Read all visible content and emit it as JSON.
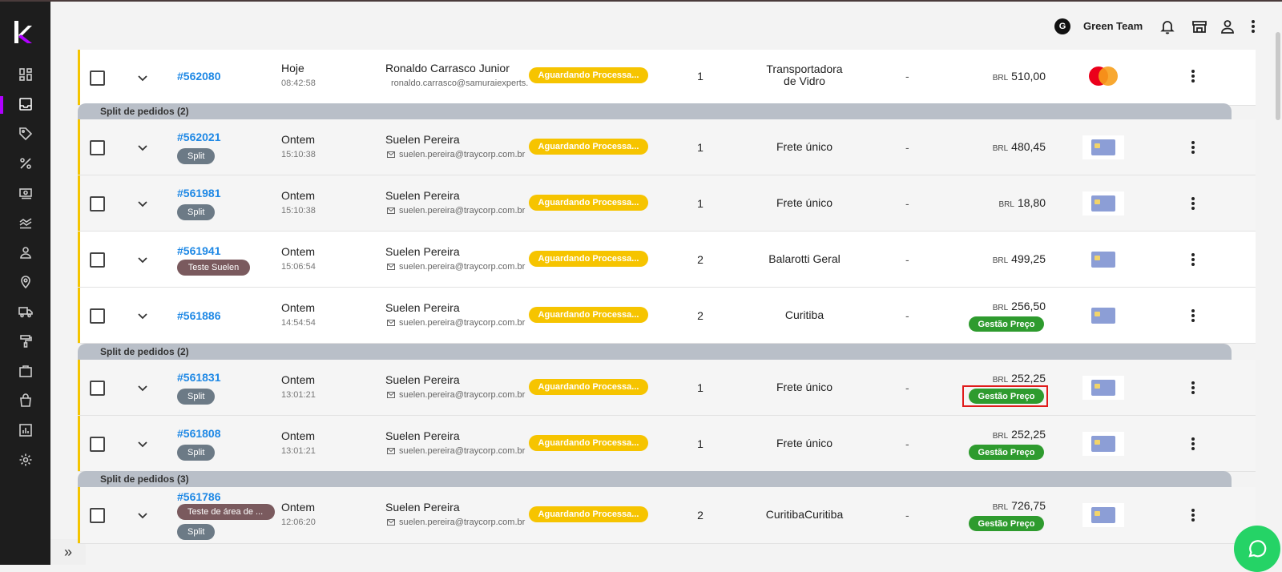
{
  "header": {
    "team_initial": "G",
    "team_name": "Green Team"
  },
  "sidebar": {
    "items": [
      {
        "icon": "dashboard-icon"
      },
      {
        "icon": "inbox-icon",
        "active": true
      },
      {
        "icon": "tag-icon"
      },
      {
        "icon": "percent-icon"
      },
      {
        "icon": "money-icon"
      },
      {
        "icon": "chart-lines-icon"
      },
      {
        "icon": "user-icon"
      },
      {
        "icon": "location-pin-icon"
      },
      {
        "icon": "truck-icon"
      },
      {
        "icon": "paint-roller-icon"
      },
      {
        "icon": "briefcase-icon"
      },
      {
        "icon": "shopping-bag-icon"
      },
      {
        "icon": "report-icon"
      },
      {
        "icon": "settings-icon"
      }
    ],
    "collapse_label": "»"
  },
  "groups": [
    {
      "label": "Split de pedidos (2)"
    },
    {
      "label": "Split de pedidos (2)"
    },
    {
      "label": "Split de pedidos (3)"
    }
  ],
  "orders": [
    {
      "id": "#562080",
      "tags": [],
      "date": "Hoje",
      "time": "08:42:58",
      "customer": "Ronaldo Carrasco Junior",
      "email": "ronaldo.carrasco@samuraiexperts.com",
      "status": "Aguardando Processa...",
      "qty": "1",
      "shipping_line1": "Transportadora",
      "shipping_line2": "de Vidro",
      "dash": "-",
      "currency": "BRL",
      "amount": "510,00",
      "price_tag": "",
      "payment": "mastercard"
    },
    {
      "id": "#562021",
      "tags": [
        "Split"
      ],
      "date": "Ontem",
      "time": "15:10:38",
      "customer": "Suelen Pereira",
      "email": "suelen.pereira@traycorp.com.br",
      "status": "Aguardando Processa...",
      "qty": "1",
      "shipping_line1": "Frete único",
      "shipping_line2": "",
      "dash": "-",
      "currency": "BRL",
      "amount": "480,45",
      "price_tag": "",
      "payment": "card"
    },
    {
      "id": "#561981",
      "tags": [
        "Split"
      ],
      "date": "Ontem",
      "time": "15:10:38",
      "customer": "Suelen Pereira",
      "email": "suelen.pereira@traycorp.com.br",
      "status": "Aguardando Processa...",
      "qty": "1",
      "shipping_line1": "Frete único",
      "shipping_line2": "",
      "dash": "-",
      "currency": "BRL",
      "amount": "18,80",
      "price_tag": "",
      "payment": "card"
    },
    {
      "id": "#561941",
      "tags": [
        "Teste Suelen"
      ],
      "date": "Ontem",
      "time": "15:06:54",
      "customer": "Suelen Pereira",
      "email": "suelen.pereira@traycorp.com.br",
      "status": "Aguardando Processa...",
      "qty": "2",
      "shipping_line1": "Balarotti Geral",
      "shipping_line2": "",
      "dash": "-",
      "currency": "BRL",
      "amount": "499,25",
      "price_tag": "",
      "payment": "card"
    },
    {
      "id": "#561886",
      "tags": [],
      "date": "Ontem",
      "time": "14:54:54",
      "customer": "Suelen Pereira",
      "email": "suelen.pereira@traycorp.com.br",
      "status": "Aguardando Processa...",
      "qty": "2",
      "shipping_line1": "Curitiba",
      "shipping_line2": "",
      "dash": "-",
      "currency": "BRL",
      "amount": "256,50",
      "price_tag": "Gestão Preço",
      "payment": "card"
    },
    {
      "id": "#561831",
      "tags": [
        "Split"
      ],
      "date": "Ontem",
      "time": "13:01:21",
      "customer": "Suelen Pereira",
      "email": "suelen.pereira@traycorp.com.br",
      "status": "Aguardando Processa...",
      "qty": "1",
      "shipping_line1": "Frete único",
      "shipping_line2": "",
      "dash": "-",
      "currency": "BRL",
      "amount": "252,25",
      "price_tag": "Gestão Preço",
      "payment": "card"
    },
    {
      "id": "#561808",
      "tags": [
        "Split"
      ],
      "date": "Ontem",
      "time": "13:01:21",
      "customer": "Suelen Pereira",
      "email": "suelen.pereira@traycorp.com.br",
      "status": "Aguardando Processa...",
      "qty": "1",
      "shipping_line1": "Frete único",
      "shipping_line2": "",
      "dash": "-",
      "currency": "BRL",
      "amount": "252,25",
      "price_tag": "Gestão Preço",
      "payment": "card"
    },
    {
      "id": "#561786",
      "tags": [
        "Teste de área de ...",
        "Split"
      ],
      "date": "Ontem",
      "time": "12:06:20",
      "customer": "Suelen Pereira",
      "email": "suelen.pereira@traycorp.com.br",
      "status": "Aguardando Processa...",
      "qty": "2",
      "shipping_line1": "CuritibaCuritiba",
      "shipping_line2": "",
      "dash": "-",
      "currency": "BRL",
      "amount": "726,75",
      "price_tag": "Gestão Preço",
      "payment": "card"
    }
  ]
}
